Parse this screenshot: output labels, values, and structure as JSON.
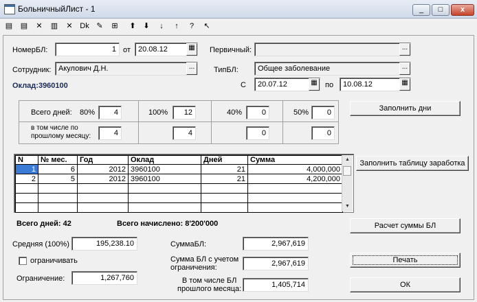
{
  "window": {
    "title": "БольничныйЛист - 1",
    "min": "_",
    "max": "□",
    "close": "x"
  },
  "toolbar": [
    {
      "name": "new-icon",
      "glyph": "▤"
    },
    {
      "name": "add-row-icon",
      "glyph": "▤"
    },
    {
      "name": "delete-row-icon",
      "glyph": "✕"
    },
    {
      "name": "copy-icon",
      "glyph": "▥"
    },
    {
      "name": "delete-icon",
      "glyph": "✕"
    },
    {
      "name": "dk-icon",
      "glyph": "Dk"
    },
    {
      "name": "edit-icon",
      "glyph": "✎"
    },
    {
      "name": "grid-icon",
      "glyph": "⊞"
    },
    {
      "name": "arrow-up-icon",
      "glyph": "⬆"
    },
    {
      "name": "arrow-down-icon",
      "glyph": "⬇"
    },
    {
      "name": "sort-asc-icon",
      "glyph": "↓"
    },
    {
      "name": "sort-desc-icon",
      "glyph": "↑"
    },
    {
      "name": "help-icon",
      "glyph": "?"
    },
    {
      "name": "pointer-help-icon",
      "glyph": "↖"
    }
  ],
  "form": {
    "nomer_label": "НомерБЛ:",
    "nomer_value": "1",
    "ot_label": "от",
    "ot_date": "20.08.12",
    "pervichny_label": "Первичный:",
    "pervichny_value": "",
    "sotrudnik_label": "Сотрудник:",
    "sotrudnik_value": "Акулович Д.Н.",
    "tipbl_label": "ТипБЛ:",
    "tipbl_value": "Общее заболевание",
    "oklad_text": "Оклад:3960100",
    "s_label": "С",
    "s_date": "20.07.12",
    "po_label": "по",
    "po_date": "10.08.12",
    "ellipsis": "..."
  },
  "days": {
    "total_label": "Всего дней:",
    "prev_label_1": "в том числе по",
    "prev_label_2": "прошлому месяцу:",
    "p80": "80%",
    "p100": "100%",
    "p40": "40%",
    "p50": "50%",
    "v80": "4",
    "v100": "12",
    "v40": "0",
    "v50": "0",
    "pv80": "4",
    "pv100": "4",
    "pv40": "0",
    "pv50": "0",
    "fill_button": "Заполнить дни"
  },
  "grid": {
    "headers": [
      "N",
      "№ мес.",
      "Год",
      "Оклад",
      "Дней",
      "Сумма"
    ],
    "rows": [
      [
        "1",
        "6",
        "2012",
        "3960100",
        "21",
        "4,000,000"
      ],
      [
        "2",
        "5",
        "2012",
        "3960100",
        "21",
        "4,200,000"
      ]
    ],
    "fill_table_button": "Заполнить таблицу заработка"
  },
  "totals": {
    "days_label": "Всего дней:",
    "days_value": "42",
    "accrued_label": "Всего начислено:",
    "accrued_value": "8'200'000",
    "calc_button": "Расчет суммы БЛ"
  },
  "summary": {
    "avg_label": "Средняя (100%)",
    "avg_value": "195,238.10",
    "limit_check_label": "ограничивать",
    "limit_label": "Ограничение:",
    "limit_value": "1,267,760",
    "sum_label": "СуммаБЛ:",
    "sum_value": "2,967,619",
    "sum_limit_label_1": "Сумма БЛ с учетом",
    "sum_limit_label_2": "ограничения:",
    "sum_limit_value": "2,967,619",
    "prev_label_1": "В том числе БЛ",
    "prev_label_2": "прошлого месяца:",
    "prev_value": "1,405,714",
    "print_button": "Печать",
    "ok_button": "ОК"
  }
}
